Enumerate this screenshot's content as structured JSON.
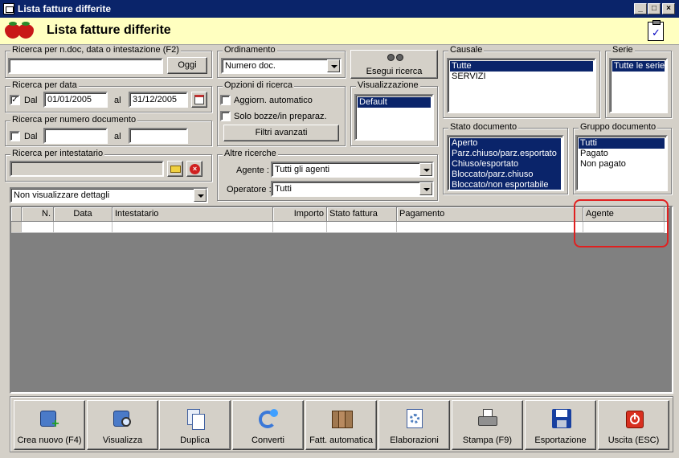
{
  "window": {
    "title": "Lista fatture differite"
  },
  "header": {
    "title": "Lista fatture differite"
  },
  "search_text": {
    "legend": "Ricerca per n.doc, data o intestazione (F2)",
    "value": "",
    "button": "Oggi"
  },
  "search_date": {
    "legend": "Ricerca per data",
    "from_label": "Dal",
    "from_checked": true,
    "from_value": "01/01/2005",
    "to_label": "al",
    "to_value": "31/12/2005"
  },
  "search_number": {
    "legend": "Ricerca per numero documento",
    "from_label": "Dal",
    "from_checked": false,
    "from_value": "",
    "to_label": "al",
    "to_value": ""
  },
  "search_holder": {
    "legend": "Ricerca per intestatario",
    "value": ""
  },
  "details_select": {
    "value": "Non visualizzare dettagli"
  },
  "ordering": {
    "legend": "Ordinamento",
    "value": "Numero doc."
  },
  "search_options": {
    "legend": "Opzioni di ricerca",
    "auto_update": "Aggiorn. automatico",
    "auto_update_checked": false,
    "drafts_only": "Solo bozze/in preparaz.",
    "drafts_only_checked": false,
    "advanced_filters": "Filtri avanzati"
  },
  "execute_search": {
    "label": "Esegui ricerca"
  },
  "view": {
    "legend": "Visualizzazione",
    "items": [
      "Default"
    ],
    "selected": 0
  },
  "other_searches": {
    "legend": "Altre ricerche",
    "agent_label": "Agente :",
    "agent_value": "Tutti gli agenti",
    "operator_label": "Operatore :",
    "operator_value": "Tutti"
  },
  "causale": {
    "legend": "Causale",
    "items": [
      "Tutte",
      "SERVIZI"
    ],
    "selected": [
      0
    ]
  },
  "serie": {
    "legend": "Serie",
    "items": [
      "Tutte le serie"
    ],
    "selected": [
      0
    ]
  },
  "doc_state": {
    "legend": "Stato documento",
    "items": [
      "Aperto",
      "Parz.chiuso/parz.esportato",
      "Chiuso/esportato",
      "Bloccato/parz.chiuso",
      "Bloccato/non esportabile"
    ],
    "selected": [
      0,
      1,
      2,
      3,
      4
    ]
  },
  "doc_group": {
    "legend": "Gruppo documento",
    "items": [
      "Tutti",
      "Pagato",
      "Non pagato"
    ],
    "selected": [
      0
    ]
  },
  "grid": {
    "columns": [
      "",
      "N.",
      "Data",
      "Intestatario",
      "Importo",
      "Stato fattura",
      "Pagamento",
      "Agente",
      ""
    ]
  },
  "toolbar": {
    "new": "Crea nuovo (F4)",
    "view": "Visualizza",
    "duplicate": "Duplica",
    "convert": "Converti",
    "auto_invoice": "Fatt. automatica",
    "processing": "Elaborazioni",
    "print": "Stampa (F9)",
    "export": "Esportazione",
    "exit": "Uscita (ESC)"
  }
}
